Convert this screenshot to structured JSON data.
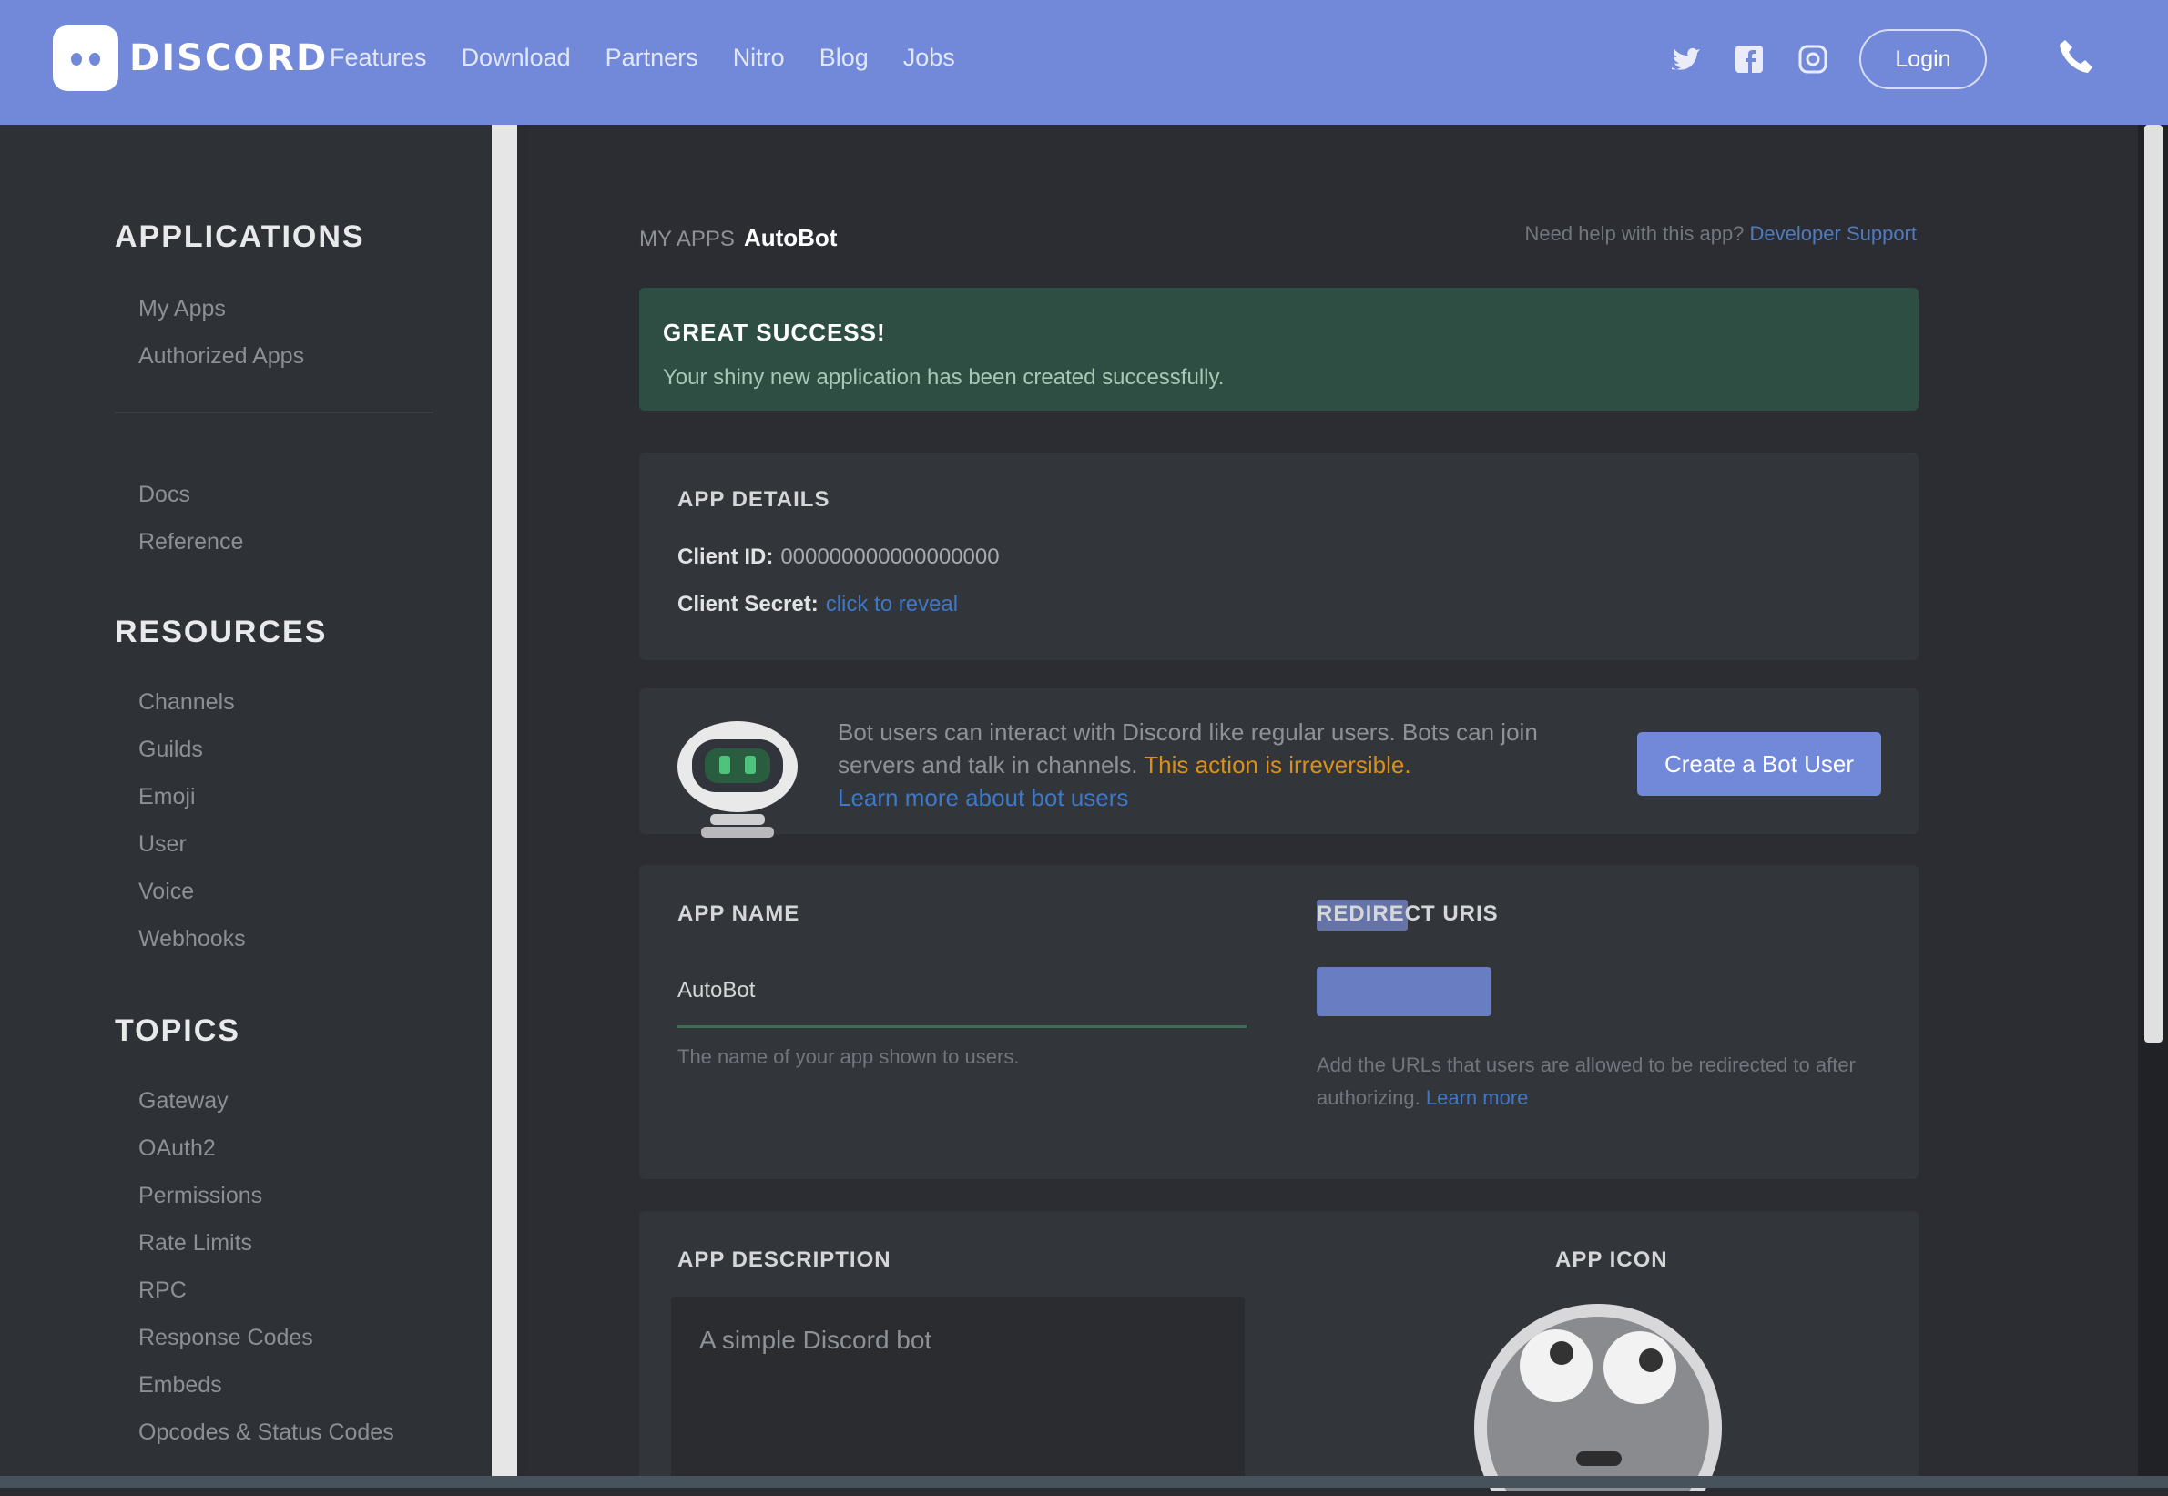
{
  "header": {
    "logo_text": "DISCORD",
    "nav": [
      "Features",
      "Download",
      "Partners",
      "Nitro",
      "Blog",
      "Jobs"
    ],
    "login_label": "Login"
  },
  "sidebar": {
    "sections": [
      {
        "title": "APPLICATIONS",
        "items": [
          "My Apps",
          "Authorized Apps"
        ]
      },
      {
        "title": "",
        "items": [
          "Docs",
          "Reference"
        ]
      },
      {
        "title": "RESOURCES",
        "items": [
          "Channels",
          "Guilds",
          "Emoji",
          "User",
          "Voice",
          "Webhooks"
        ]
      },
      {
        "title": "TOPICS",
        "items": [
          "Gateway",
          "OAuth2",
          "Permissions",
          "Rate Limits",
          "RPC",
          "Response Codes",
          "Embeds",
          "Opcodes & Status Codes"
        ]
      }
    ]
  },
  "main": {
    "breadcrumb_prefix": "MY APPS",
    "breadcrumb_current": "AutoBot",
    "top_note_prefix": "Need help with this app?",
    "top_note_link": "Developer Support",
    "success_title": "GREAT SUCCESS!",
    "success_message": "Your shiny new application has been created successfully.",
    "app_details_label": "APP DETAILS",
    "client_id_label": "Client ID:",
    "client_id_value": "000000000000000000",
    "client_secret_label": "Client Secret:",
    "client_secret_link": "click to reveal",
    "bot_text": "Bot users can interact with Discord like regular users. Bots can join servers and talk in channels.",
    "bot_warning": "This action is irreversible.",
    "bot_link": "Learn more about bot users",
    "create_bot_label": "Create a Bot User",
    "app_name_label": "APP NAME",
    "app_name_value": "AutoBot",
    "app_name_help": "The name of your app shown to users.",
    "redirect_label": "REDIRECT URIS",
    "redirect_help": "Add the URLs that users are allowed to be redirected to after authorizing.",
    "redirect_link": "Learn more",
    "description_label": "APP DESCRIPTION",
    "description_placeholder": "A simple Discord bot",
    "app_icon_label": "APP ICON"
  },
  "colors": {
    "brand": "#7289da",
    "success_bg": "#2f4e43",
    "warning": "#d8901a",
    "link": "#3f78c4"
  }
}
